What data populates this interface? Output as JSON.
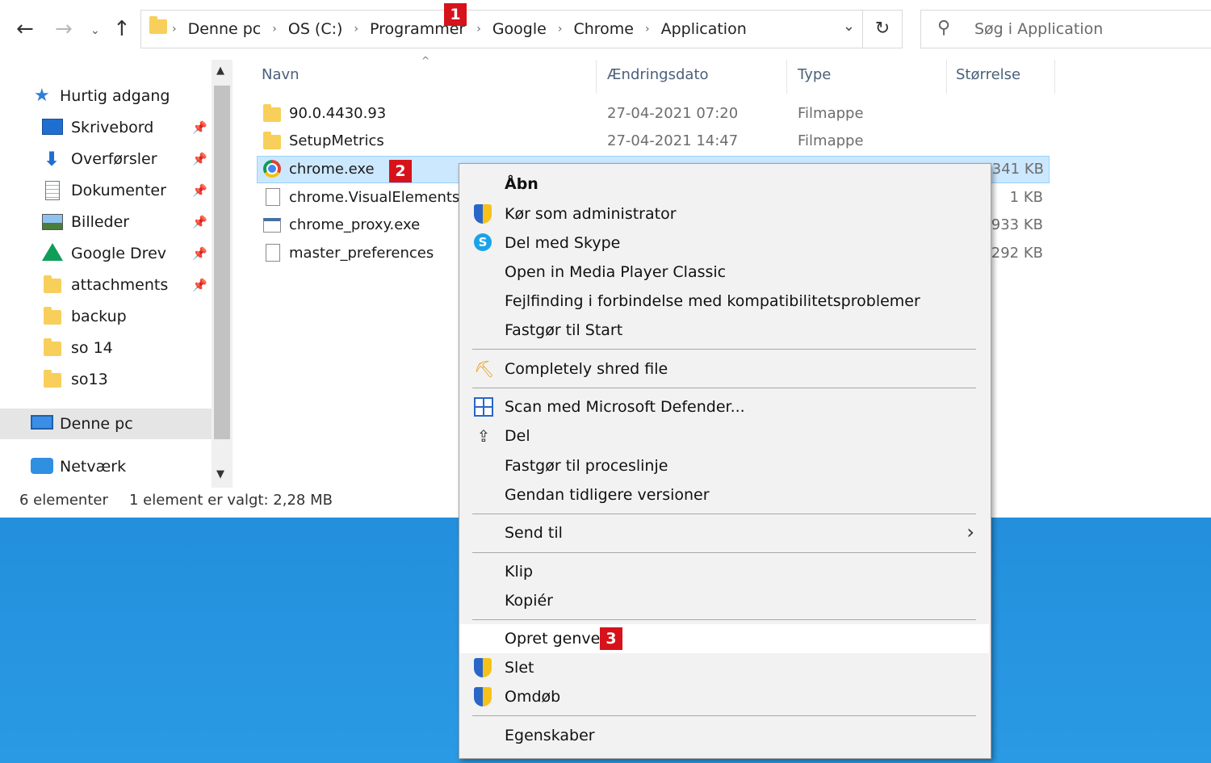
{
  "address": {
    "crumbs": [
      "Denne pc",
      "OS (C:)",
      "Programmer",
      "Google",
      "Chrome",
      "Application"
    ],
    "refresh_icon": "refresh-icon"
  },
  "search": {
    "placeholder": "Søg i Application"
  },
  "sidebar": {
    "quick_access": "Hurtig adgang",
    "items": [
      {
        "label": "Skrivebord",
        "icon": "desktop-icon",
        "pinned": true
      },
      {
        "label": "Overførsler",
        "icon": "download-icon",
        "pinned": true
      },
      {
        "label": "Dokumenter",
        "icon": "documents-icon",
        "pinned": true
      },
      {
        "label": "Billeder",
        "icon": "pictures-icon",
        "pinned": true
      },
      {
        "label": "Google Drev",
        "icon": "google-drive-icon",
        "pinned": true
      },
      {
        "label": "attachments",
        "icon": "folder-icon",
        "pinned": true
      },
      {
        "label": "backup",
        "icon": "folder-icon",
        "pinned": false
      },
      {
        "label": "so 14",
        "icon": "folder-icon",
        "pinned": false
      },
      {
        "label": "so13",
        "icon": "folder-icon",
        "pinned": false
      }
    ],
    "this_pc": "Denne pc",
    "network": "Netværk"
  },
  "columns": {
    "name": "Navn",
    "date": "Ændringsdato",
    "type": "Type",
    "size": "Størrelse"
  },
  "files": [
    {
      "name": "90.0.4430.93",
      "date": "27-04-2021 07:20",
      "type": "Filmappe",
      "size": ""
    },
    {
      "name": "SetupMetrics",
      "date": "27-04-2021 14:47",
      "type": "Filmappe",
      "size": ""
    },
    {
      "name": "chrome.exe",
      "date": "",
      "type": "",
      "size": "2.341 KB"
    },
    {
      "name": "chrome.VisualElementsManifest.xml",
      "date": "",
      "type": "",
      "size": "1 KB"
    },
    {
      "name": "chrome_proxy.exe",
      "date": "",
      "type": "",
      "size": "933 KB"
    },
    {
      "name": "master_preferences",
      "date": "",
      "type": "",
      "size": "292 KB"
    }
  ],
  "status": {
    "count": "6 elementer",
    "selected": "1 element er valgt: 2,28 MB"
  },
  "badges": [
    "1",
    "2",
    "3"
  ],
  "context_menu": {
    "open": "Åbn",
    "run_as_admin": "Kør som administrator",
    "share_skype": "Del med Skype",
    "open_mpc": "Open in Media Player Classic",
    "troubleshoot": "Fejlfinding i forbindelse med kompatibilitetsproblemer",
    "pin_start": "Fastgør til Start",
    "shred": "Completely shred file",
    "defender": "Scan med Microsoft Defender...",
    "share": "Del",
    "pin_taskbar": "Fastgør til proceslinje",
    "restore": "Gendan tidligere versioner",
    "send_to": "Send til",
    "cut": "Klip",
    "copy": "Kopiér",
    "create_shortcut": "Opret genvej",
    "delete": "Slet",
    "rename": "Omdøb",
    "properties": "Egenskaber"
  },
  "colors": {
    "selection": "#cce8ff",
    "badge": "#d6121a",
    "desktop": "#1e86d6"
  }
}
